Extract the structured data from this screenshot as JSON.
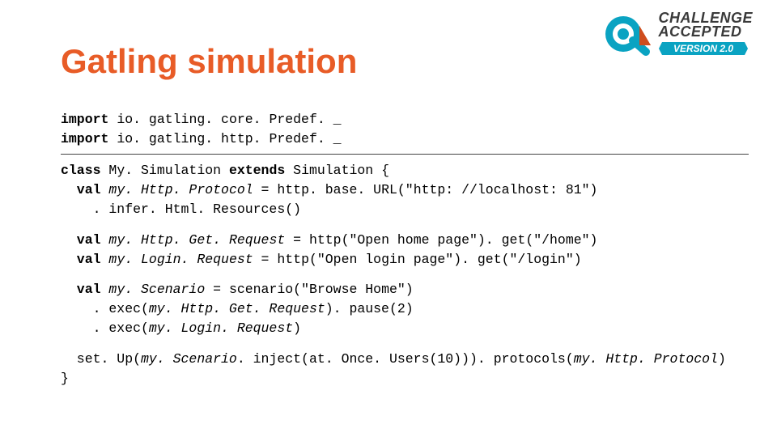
{
  "title": "Gatling simulation",
  "logo": {
    "line1": "CHALLENGE",
    "line2": "ACCEPTED",
    "version": "VERSION 2.0"
  },
  "code": {
    "import_kw": "import",
    "import1_rest": " io. gatling. core. Predef. _",
    "import2_rest": " io. gatling. http. Predef. _",
    "class_kw": "class",
    "classname": " My. Simulation ",
    "extends_kw": "extends",
    "classrest": " Simulation {",
    "val_kw": "val",
    "httpproto_name": " my. Http. Protocol",
    "httpproto_rest": " = http. base. URL(\"http: //localhost: 81\")",
    "infer": ". infer. Html. Resources()",
    "getreq_name": " my. Http. Get. Request",
    "getreq_rest": " = http(\"Open home page\"). get(\"/home\")",
    "loginreq_name": " my. Login. Request",
    "loginreq_rest": " = http(\"Open login page\"). get(\"/login\")",
    "scen_name": " my. Scenario",
    "scen_rest": " = scenario(\"Browse Home\")",
    "exec1_a": ". exec(",
    "exec1_b": "my. Http. Get. Request",
    "exec1_c": "). pause(2)",
    "exec2_a": ". exec(",
    "exec2_b": "my. Login. Request",
    "exec2_c": ")",
    "setup_a": "set. Up(",
    "setup_b": "my. Scenario",
    "setup_c": ". inject(at. Once. Users(10))). protocols(",
    "setup_d": "my. Http. Protocol",
    "setup_e": ")",
    "close": "}"
  }
}
